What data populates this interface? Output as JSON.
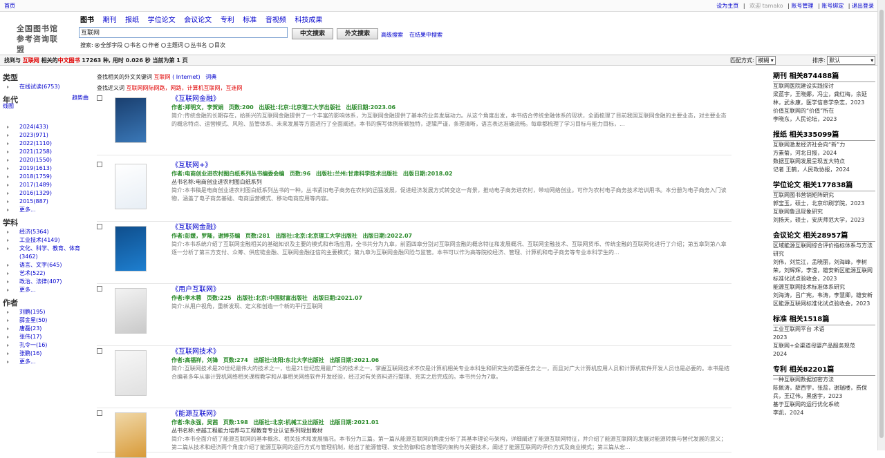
{
  "topbar": {
    "home": "首页",
    "links": [
      "设为主页",
      "欢迎 tamako",
      "账号管理",
      "账号绑定",
      "退出登录"
    ]
  },
  "logo": {
    "line1": "全国图书馆",
    "line2": "参考咨询联盟"
  },
  "tabs": [
    "图书",
    "期刊",
    "报纸",
    "学位论文",
    "会议论文",
    "专利",
    "标准",
    "音视频",
    "科技成果"
  ],
  "search": {
    "value": "互联网",
    "btn_cn": "中文搜索",
    "btn_foreign": "外文搜索",
    "advanced": "高级搜索",
    "in_results": "在结果中搜索",
    "fields_label": "搜索:",
    "fields": [
      "全部字段",
      "书名",
      "作者",
      "主题词",
      "丛书名",
      "目次"
    ]
  },
  "result": {
    "pre": "找到与",
    "keyword": "互联网",
    "mid": "相关的",
    "cat": "中文图书",
    "count": "17263",
    "rest": "种, 用时 0.026 秒 当前为第 1 页",
    "match_label": "匹配方式:",
    "match_value": "模糊",
    "sort_label": "排序:",
    "sort_value": "默认"
  },
  "sidebar": {
    "type_h": "类型",
    "type_items": [
      "在线试读(6753)"
    ],
    "year_h": "年代",
    "trend": "趋势曲线图",
    "year_items": [
      "2024(433)",
      "2023(971)",
      "2022(1110)",
      "2021(1258)",
      "2020(1550)",
      "2019(1613)",
      "2018(1759)",
      "2017(1489)",
      "2016(1329)",
      "2015(887)"
    ],
    "more": "更多...",
    "subject_h": "学科",
    "subject_items": [
      "经济(5364)",
      "工业技术(4149)",
      "文化、科学、教育、体育(3462)",
      "语言、文字(645)",
      "艺术(522)",
      "政治、法律(407)"
    ],
    "author_h": "作者",
    "author_items": [
      "刘鹏(195)",
      "薛金星(50)",
      "唐磊(23)",
      "张伟(17)",
      "孔令一(16)",
      "张鹏(16)"
    ]
  },
  "related": {
    "foreign_label": "查找相关的外文关键词",
    "foreign_kw": "互联网",
    "foreign_en": "( Internet)",
    "dict": "词典",
    "near_label": "查找近义词",
    "near_words": "互联网网际网路，网路，计算机互联网，互连网"
  },
  "books": [
    {
      "title": "《互联网金融》",
      "author": "作者:郑明文，李贺娟",
      "pages": "页数:200",
      "pub": "出版社:北京:北京理工大学出版社",
      "date": "出版日期:2023.06",
      "series": "",
      "desc": "简介:传统金融的长期存在，给新兴的互联网金融提供了一个丰富的影响体系，为互联网金融提供了基本的业务发展动力。从这个角度出发，本书结合传统金融体系的现状，全面梳理了目前我国互联网金融的主要业态，对主要业态的概念特点、运营模式、风险、监管体系、未来发展等方面进行了全面阐述。本书的撰写体例新颖独特，逻辑严谨，条理清晰，语言表达准确流畅。每章都梳理了学习目标与能力目标，..."
    },
    {
      "title": "《互联网+》",
      "author": "作者:电商创业进农村图白纸系列丛书编委会编",
      "pages": "页数:96",
      "pub": "出版社:兰州:甘肃科学技术出版社",
      "date": "出版日期:2018.02",
      "series": "丛书名称:电商创业进农村图白纸系列",
      "desc": "简介:本书稿是电商创业进农村图白纸系列丛书的一种。丛书紧扣电子商务在农村的迅猛发展，促进经济发展方式转变这一背景，推动电子商务进农村，带动网络创业。可作为农村电子商务技术培训用书。本分册为电子商务入门读物，涵盖了电子商务基础、电商运营模式、移动电商应用等内容。"
    },
    {
      "title": "《互联网金融》",
      "author": "作者:彭媛，罗隆，谢婷芬编",
      "pages": "页数:281",
      "pub": "出版社:北京:北京理工大学出版社",
      "date": "出版日期:2022.07",
      "series": "",
      "desc": "简介:本书系统介绍了互联网金融相关的基础知识及主要的模式和市场应用，全书共分为九章，前面四章分别对互联网金融的概念特征和发展概况、互联网金融技术、互联网货币、传统金融的互联网化进行了介绍；第五章到第八章逐一分析了第三方支付、众筹、供应链金融、互联网金融征信的主要模式；第九章为互联网金融风险与监管。本书可以作为高等院校经济、管理、计算机和电子商务等专业本科学生的..."
    },
    {
      "title": "《用户互联网》",
      "author": "作者:李木蓉",
      "pages": "页数:225",
      "pub": "出版社:北京:中国财富出版社",
      "date": "出版日期:2021.07",
      "series": "",
      "desc": "简介:从用户视角，重新发现、定义和创造一个新的平行互联网"
    },
    {
      "title": "《互联网技术》",
      "author": "作者:高福祥，刘锋",
      "pages": "页数:274",
      "pub": "出版社:沈阳:东北大学出版社",
      "date": "出版日期:2021.06",
      "series": "",
      "desc": "简介:互联网技术是20世纪最伟大的技术之一，也是21世纪应用最广泛的技术之一，掌握互联网技术不仅是计算机相关专业本科生和研究生的重要任务之一，而且对广大计算机应用人员和计算机软件开发人员也是必要的。本书是结合编者多年从事计算机网络相关课程教学和从事相关网络软件开发经验，经过对有关资料进行整理、充实之后完成的。本书共分为7章。"
    },
    {
      "title": "《能源互联网》",
      "author": "作者:朱永强，吴茜",
      "pages": "页数:198",
      "pub": "出版社:北京:机械工业出版社",
      "date": "出版日期:2021.01",
      "series": "丛书名称:卓越工程能力培养与工程教育专业认证系列规划教材",
      "desc": "简介:本书全面介绍了能源互联网的基本概念、相关技术和发展情况。本书分为三篇。第一篇从能源互联网的角度分析了其基本理论与架构，详细阐述了能源互联网特征，并介绍了能源互联网的发展对能源转换与替代发展的意义；第二篇从技术和经济两个角度介绍了能源互联网的运行方式与管理机制，给出了能源管理、安全防御和信息管理的架构与关键技术，阐述了能源互联网的评价方式及商业模式；第三篇从宏..."
    }
  ],
  "right": [
    {
      "head": "期刊 相关874488篇",
      "items": [
        {
          "t": "互联网医院建设实践探讨",
          "link": true
        },
        {
          "t": "梁蓝宇，王晓娜，冯尘，龚红梅，余延林，武永康，医学信息学杂志，2023",
          "link": false
        },
        {
          "t": "价值互联网的“价值”所在",
          "link": true
        },
        {
          "t": "李晓东，人民论坛，2023",
          "link": false
        }
      ]
    },
    {
      "head": "报纸 相关335099篇",
      "items": [
        {
          "t": "互联网激发经济社会向“新”力",
          "link": true
        },
        {
          "t": "方素菊，河北日报，2024",
          "link": false
        },
        {
          "t": "数据互联网发展呈现五大特点",
          "link": true
        },
        {
          "t": "记者 王鹤，人民政协报，2024",
          "link": false
        }
      ]
    },
    {
      "head": "学位论文 相关177838篇",
      "items": [
        {
          "t": "互联网图书营销矩阵研究",
          "link": true
        },
        {
          "t": "郭宝玉，硕士，北京印刷学院，2023",
          "link": false
        },
        {
          "t": "互联网鲁迅现象研究",
          "link": true
        },
        {
          "t": "刘扬天，硕士，安庆师范大学，2023",
          "link": false
        }
      ]
    },
    {
      "head": "会议论文 相关28957篇",
      "items": [
        {
          "t": "区域能源互联网综合评价指标体系与方法研究",
          "link": true
        },
        {
          "t": "刘伟，刘荒江，孟晓丽，刘海峰，李树荣，刘辉辉，李滢，雄安新区能源互联网标准化试点验收会，2023",
          "link": false
        },
        {
          "t": "能源互联网技术标准体系研究",
          "link": true
        },
        {
          "t": "刘海涛，吕广宪，韦涛，李慧卿，雄安新区能源互联网标准化试点验收会，2023",
          "link": false
        }
      ]
    },
    {
      "head": "标准 相关1518篇",
      "items": [
        {
          "t": "工业互联网平台 术语",
          "link": true
        },
        {
          "t": "2023",
          "link": false
        },
        {
          "t": "互联网+全渠道母婴产品服务规范",
          "link": true
        },
        {
          "t": "2024",
          "link": false
        }
      ]
    },
    {
      "head": "专利 相关82201篇",
      "items": [
        {
          "t": "一种互联网数据加密方法",
          "link": true
        },
        {
          "t": "陈佩涛，薛西宇，张蕊，谢瑞楼，费保兵，王辽伟，黑盛宇，2023",
          "link": false
        },
        {
          "t": "基于互联网的运行优化系统",
          "link": true
        },
        {
          "t": "李凯，2024",
          "link": false
        }
      ]
    }
  ]
}
